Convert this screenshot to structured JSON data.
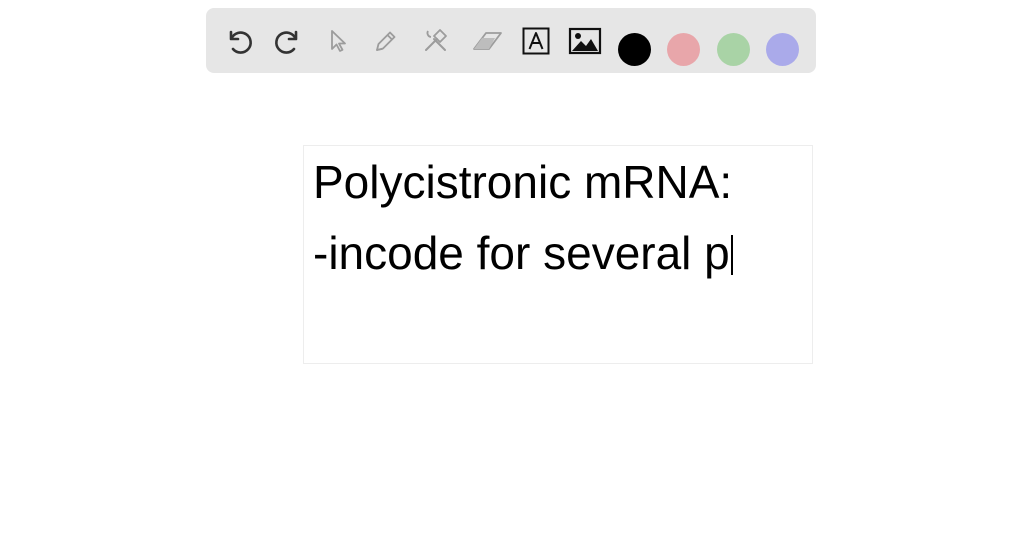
{
  "toolbar": {
    "tools": [
      {
        "name": "undo",
        "icon": "undo-icon",
        "enabled": true
      },
      {
        "name": "redo",
        "icon": "redo-icon",
        "enabled": true
      },
      {
        "name": "select",
        "icon": "pointer-icon",
        "enabled": false
      },
      {
        "name": "pen",
        "icon": "pencil-icon",
        "enabled": false
      },
      {
        "name": "tools",
        "icon": "tools-icon",
        "enabled": false
      },
      {
        "name": "eraser",
        "icon": "eraser-icon",
        "enabled": false
      },
      {
        "name": "text",
        "icon": "text-box-icon",
        "enabled": true,
        "glyph": "A"
      },
      {
        "name": "image",
        "icon": "image-icon",
        "enabled": true
      }
    ],
    "colors": [
      {
        "name": "black",
        "hex": "#000000",
        "selected": true
      },
      {
        "name": "red",
        "hex": "#e8a6aa",
        "selected": false
      },
      {
        "name": "green",
        "hex": "#a9d3a6",
        "selected": false
      },
      {
        "name": "purple",
        "hex": "#aaaaea",
        "selected": false
      }
    ]
  },
  "textbox": {
    "lines": [
      "Polycistronic mRNA:",
      "-incode for several p"
    ]
  }
}
